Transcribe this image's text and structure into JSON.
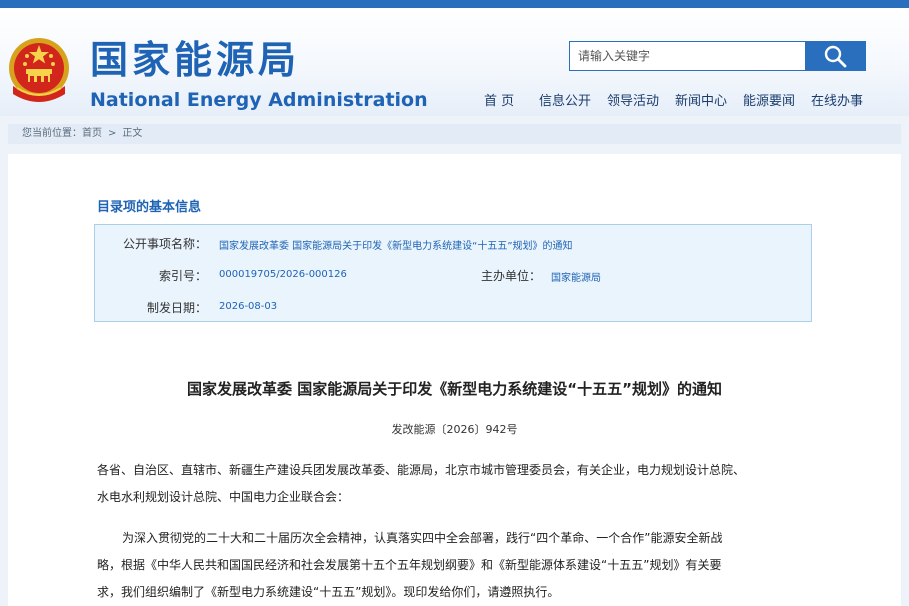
{
  "header": {
    "title_cn": "国家能源局",
    "title_en": "National Energy Administration",
    "emblem_icon": "national-emblem-icon"
  },
  "search": {
    "placeholder": "请输入关键字",
    "icon": "search-icon"
  },
  "nav": {
    "items": [
      "首 页",
      "信息公开",
      "领导活动",
      "新闻中心",
      "能源要闻",
      "在线办事"
    ]
  },
  "breadcrumb": {
    "prefix": "您当前位置：",
    "items": [
      "首页",
      "正文"
    ],
    "separator": ">"
  },
  "info": {
    "title": "目录项的基本信息",
    "rows": {
      "subject": {
        "label": "公开事项名称：",
        "value": "国家发展改革委 国家能源局关于印发《新型电力系统建设“十五五”规划》的通知"
      },
      "index": {
        "label": "索引号：",
        "value": "000019705/2026-000126"
      },
      "organizer": {
        "label": "主办单位：",
        "value": "国家能源局"
      },
      "date": {
        "label": "制发日期：",
        "value": "2026-08-03"
      }
    }
  },
  "document": {
    "title": "国家发展改革委 国家能源局关于印发《新型电力系统建设“十五五”规划》的通知",
    "number": "发改能源〔2026〕942号",
    "addressee_lines": [
      "各省、自治区、直辖市、新疆生产建设兵团发展改革委、能源局，北京市城市管理委员会，有关企业，电力规划设计总院、",
      "水电水利规划设计总院、中国电力企业联合会："
    ],
    "body_lines": [
      "为深入贯彻党的二十大和二十届历次全会精神，认真落实四中全会部署，践行“四个革命、一个合作”能源安全新战",
      "略，根据《中华人民共和国国民经济和社会发展第十五个五年规划纲要》和《新型能源体系建设“十五五”规划》有关要",
      "求，我们组织编制了《新型电力系统建设“十五五”规划》。现印发给你们，请遵照执行。"
    ]
  },
  "colors": {
    "brand_blue": "#1f63b5",
    "info_bg": "#e9f4fc",
    "info_border": "#a9cfe9"
  }
}
